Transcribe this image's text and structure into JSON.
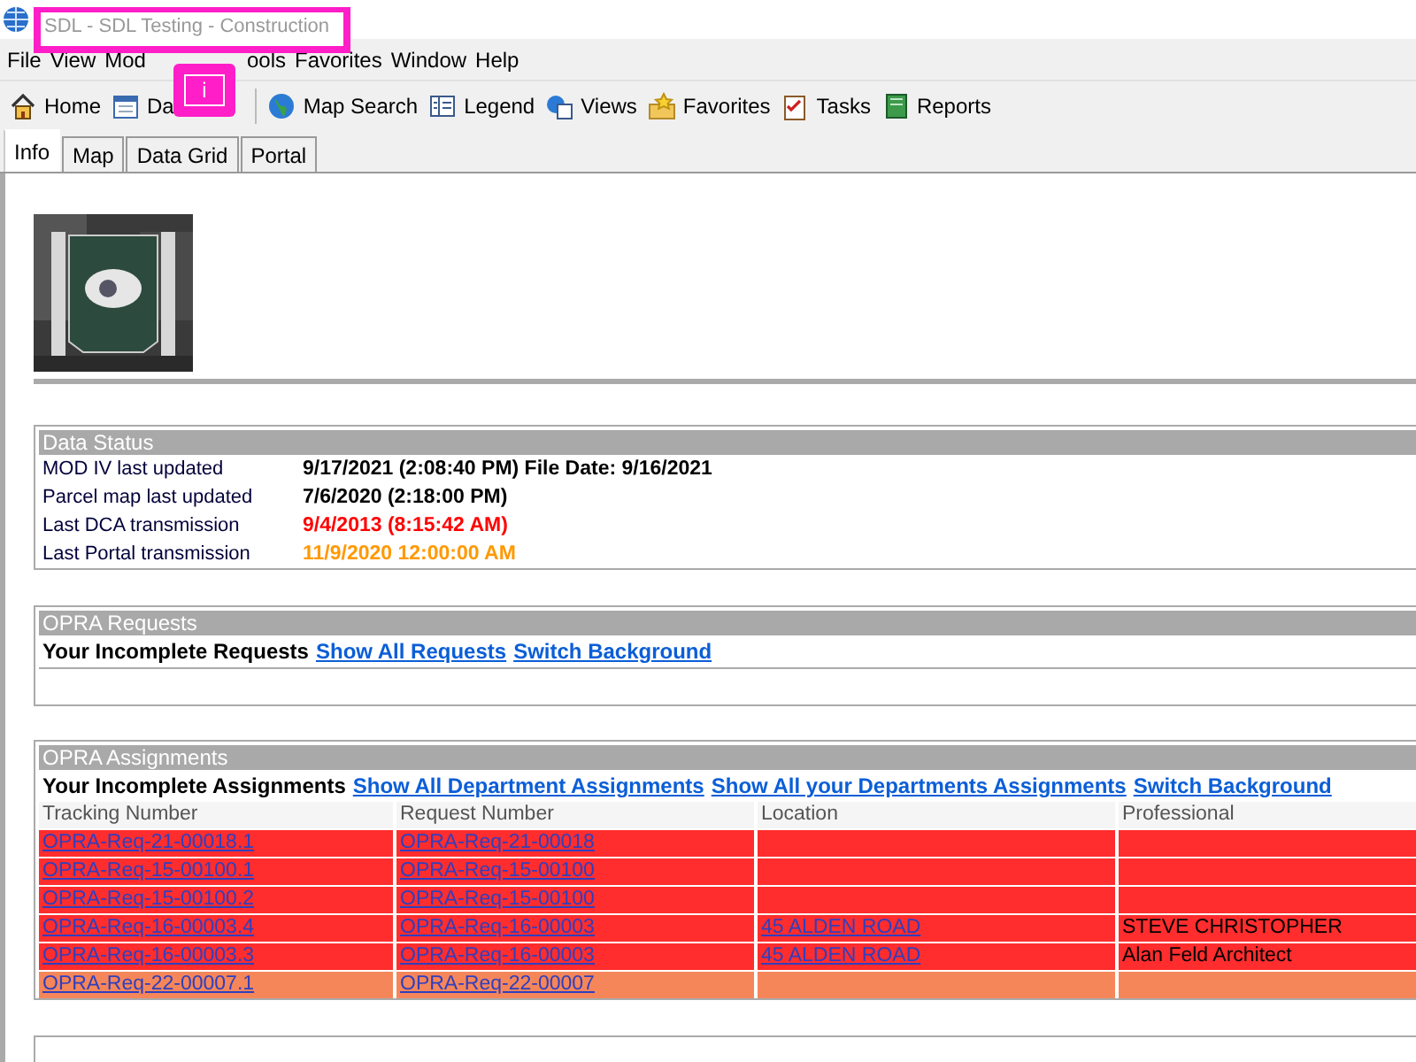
{
  "window": {
    "title": "SDL - SDL Testing - Construction"
  },
  "annotation": {
    "label": "i"
  },
  "menu": [
    {
      "label": "File"
    },
    {
      "label": "View"
    },
    {
      "label": "Mod"
    },
    {
      "label": "ools"
    },
    {
      "label": "Favorites"
    },
    {
      "label": "Window"
    },
    {
      "label": "Help"
    }
  ],
  "toolbar": [
    {
      "kind": "home",
      "label": "Home"
    },
    {
      "kind": "calendar",
      "label": "Da"
    },
    {
      "kind": "globe",
      "label": "Map Search"
    },
    {
      "kind": "legend",
      "label": "Legend"
    },
    {
      "kind": "views",
      "label": "Views"
    },
    {
      "kind": "star",
      "label": "Favorites"
    },
    {
      "kind": "tasks",
      "label": "Tasks"
    },
    {
      "kind": "book",
      "label": "Reports"
    }
  ],
  "tabs": [
    {
      "label": "Info",
      "selected": true
    },
    {
      "label": "Map",
      "selected": false
    },
    {
      "label": "Data Grid",
      "selected": false
    },
    {
      "label": "Portal",
      "selected": false
    }
  ],
  "data_status": {
    "title": "Data Status",
    "rows": [
      {
        "label": "MOD IV last updated",
        "value": "9/17/2021 (2:08:40 PM) File Date: 9/16/2021",
        "color": "#000000"
      },
      {
        "label": "Parcel map last updated",
        "value": "7/6/2020 (2:18:00 PM)",
        "color": "#000000"
      },
      {
        "label": "Last DCA transmission",
        "value": "9/4/2013 (8:15:42 AM)",
        "color": "#ff0000"
      },
      {
        "label": "Last Portal transmission",
        "value": "11/9/2020 12:00:00 AM",
        "color": "#ff9900"
      }
    ]
  },
  "opra_requests": {
    "title": "OPRA Requests",
    "heading": "Your Incomplete Requests",
    "links": [
      "Show All Requests",
      "Switch Background"
    ]
  },
  "opra_assignments": {
    "title": "OPRA Assignments",
    "heading": "Your Incomplete Assignments",
    "links": [
      "Show All Department Assignments",
      "Show All your Departments Assignments",
      "Switch Background"
    ],
    "columns": [
      "Tracking Number",
      "Request Number",
      "Location",
      "Professional"
    ],
    "rows": [
      {
        "tracking": "OPRA-Req-21-00018.1",
        "request": "OPRA-Req-21-00018",
        "location": "",
        "professional": "",
        "color": "#ff2d2d"
      },
      {
        "tracking": "OPRA-Req-15-00100.1",
        "request": "OPRA-Req-15-00100",
        "location": "",
        "professional": "",
        "color": "#ff2d2d"
      },
      {
        "tracking": "OPRA-Req-15-00100.2",
        "request": "OPRA-Req-15-00100",
        "location": "",
        "professional": "",
        "color": "#ff2d2d"
      },
      {
        "tracking": "OPRA-Req-16-00003.4",
        "request": "OPRA-Req-16-00003",
        "location": "45 ALDEN ROAD",
        "professional": "STEVE CHRISTOPHER",
        "color": "#ff2d2d"
      },
      {
        "tracking": "OPRA-Req-16-00003.3",
        "request": "OPRA-Req-16-00003",
        "location": "45 ALDEN ROAD",
        "professional": "Alan Feld Architect",
        "color": "#ff2d2d"
      },
      {
        "tracking": "OPRA-Req-22-00007.1",
        "request": "OPRA-Req-22-00007",
        "location": "",
        "professional": "",
        "color": "#f5865a"
      }
    ]
  }
}
